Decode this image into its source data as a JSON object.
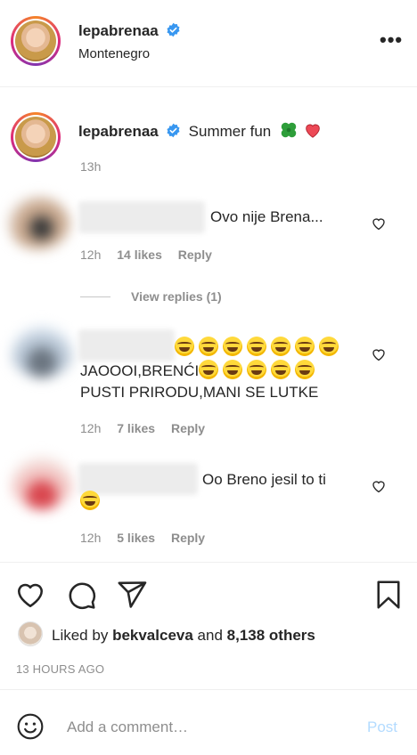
{
  "header": {
    "username": "lepabrenaa",
    "location": "Montenegro",
    "more_label": "•••"
  },
  "caption": {
    "username": "lepabrenaa",
    "text": "Summer fun",
    "time": "13h"
  },
  "comments": [
    {
      "text": "Ovo nije Brena...",
      "time": "12h",
      "likes": "14 likes",
      "reply": "Reply",
      "view_replies": "View replies (1)"
    },
    {
      "line2": "JAOOOI,BRENĆI",
      "line3": "PUSTI PRIRODU,MANI SE LUTKE",
      "time": "12h",
      "likes": "7 likes",
      "reply": "Reply"
    },
    {
      "text": "Oo Breno jesil to ti",
      "time": "12h",
      "likes": "5 likes",
      "reply": "Reply"
    }
  ],
  "likes": {
    "prefix": "Liked by",
    "user": "bekvalceva",
    "and": "and",
    "others": "8,138 others"
  },
  "time_ago": "13 HOURS AGO",
  "comment_box": {
    "placeholder": "Add a comment…",
    "post_label": "Post"
  },
  "colors": {
    "verified": "#3897f0",
    "heart": "#ed4956",
    "clover": "#2e9e3a",
    "post_disabled": "#b3dbff"
  }
}
